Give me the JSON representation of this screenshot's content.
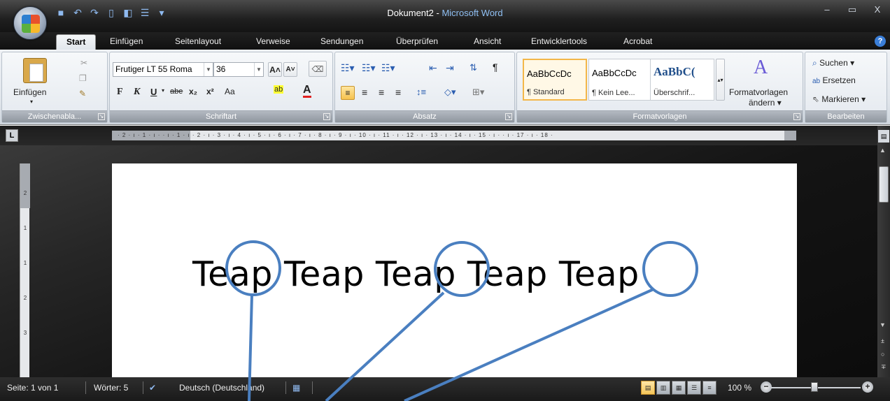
{
  "window": {
    "doc_name": "Dokument2 - ",
    "app_name": "Microsoft Word",
    "controls": [
      "–",
      "▭",
      "X"
    ]
  },
  "tabs": [
    "Start",
    "Einfügen",
    "Seitenlayout",
    "Verweise",
    "Sendungen",
    "Überprüfen",
    "Ansicht",
    "Entwicklertools",
    "Acrobat"
  ],
  "ribbon": {
    "clipboard": {
      "paste_label": "Einfügen",
      "group_label": "Zwischenabla..."
    },
    "font": {
      "font_name": "Frutiger LT 55 Roma",
      "font_size": "36",
      "group_label": "Schriftart",
      "bold": "F",
      "italic": "K",
      "underline": "U",
      "strike": "abe",
      "sub": "x₂",
      "sup": "x²",
      "case": "Aa",
      "highlight": "ab",
      "color": "A",
      "grow": "A",
      "shrink": "A"
    },
    "paragraph": {
      "group_label": "Absatz"
    },
    "styles": {
      "group_label": "Formatvorlagen",
      "items": [
        {
          "sample": "AaBbCcDc",
          "name": "¶ Standard"
        },
        {
          "sample": "AaBbCcDc",
          "name": "¶ Kein Lee..."
        },
        {
          "sample": "AaBbC(",
          "name": "Überschrif..."
        }
      ],
      "change_label_1": "Formatvorlagen",
      "change_label_2": "ändern"
    },
    "editing": {
      "group_label": "Bearbeiten",
      "find": "Suchen",
      "replace": "Ersetzen",
      "select": "Markieren"
    }
  },
  "ruler": {
    "corner": "L",
    "marks": "· 2 · ı · 1 · ı ·  · ı · 1 · ı · 2 · ı · 3 · ı · 4 · ı · 5 · ı · 6 · ı · 7 · ı · 8 · ı · 9 · ı · 10 · ı · 11 · ı · 12 · ı · 13 · ı · 14 · ı · 15 · ı ·  · ı · 17 · ı · 18 ·",
    "vertical_marks": [
      "2",
      "1",
      "",
      "1",
      "2",
      "3"
    ]
  },
  "document": {
    "text": "Teap Teap Teap Teap Teap"
  },
  "status": {
    "page": "Seite: 1 von 1",
    "words": "Wörter: 5",
    "language": "Deutsch (Deutschland)",
    "zoom": "100 %",
    "zoom_level_percent": 100
  },
  "colors": {
    "annotation": "#4a7fc0",
    "app_title": "#8fbff3"
  }
}
